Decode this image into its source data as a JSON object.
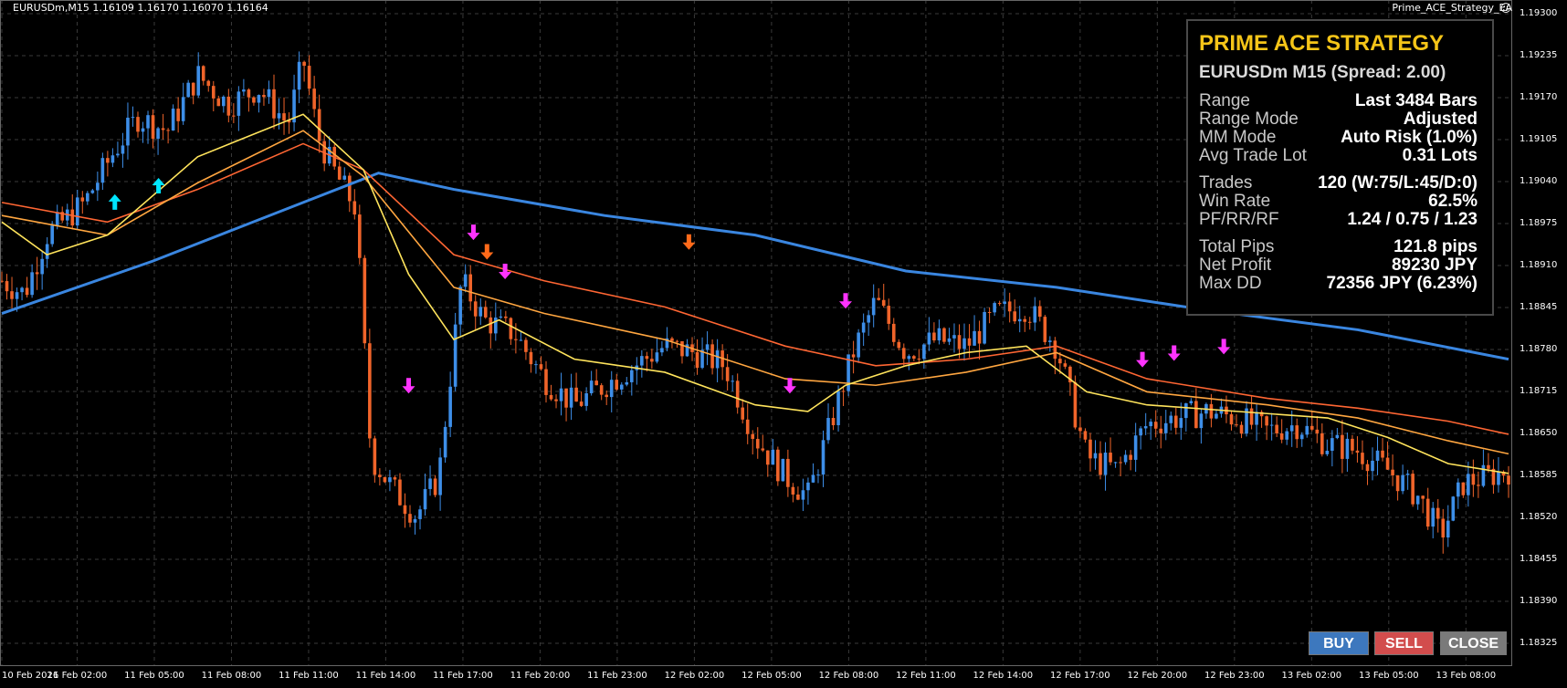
{
  "header": {
    "symbol_info": "EURUSDm,M15  1.16109 1.16170 1.16070 1.16164",
    "ea_name": "Prime_ACE_Strategy_EA",
    "ea_face": "☺"
  },
  "price_axis": {
    "ticks": [
      "1.19300",
      "1.19235",
      "1.19170",
      "1.19105",
      "1.19040",
      "1.18975",
      "1.18910",
      "1.18845",
      "1.18780",
      "1.18715",
      "1.18650",
      "1.18585",
      "1.18520",
      "1.18455",
      "1.18390",
      "1.18325"
    ]
  },
  "time_axis": {
    "ticks": [
      "10 Feb 2026",
      "11 Feb 02:00",
      "11 Feb 05:00",
      "11 Feb 08:00",
      "11 Feb 11:00",
      "11 Feb 14:00",
      "11 Feb 17:00",
      "11 Feb 20:00",
      "11 Feb 23:00",
      "12 Feb 02:00",
      "12 Feb 05:00",
      "12 Feb 08:00",
      "12 Feb 11:00",
      "12 Feb 14:00",
      "12 Feb 17:00",
      "12 Feb 20:00",
      "12 Feb 23:00",
      "13 Feb 02:00",
      "13 Feb 05:00",
      "13 Feb 08:00"
    ]
  },
  "panel": {
    "title": "PRIME ACE STRATEGY",
    "subtitle": "EURUSDm M15 (Spread: 2.00)",
    "group1": [
      {
        "label": "Range",
        "value": "Last 3484 Bars"
      },
      {
        "label": "Range Mode",
        "value": "Adjusted"
      },
      {
        "label": "MM Mode",
        "value": "Auto Risk (1.0%)"
      },
      {
        "label": "Avg Trade Lot",
        "value": "0.31 Lots"
      }
    ],
    "group2": [
      {
        "label": "Trades",
        "value": "120 (W:75/L:45/D:0)"
      },
      {
        "label": "Win Rate",
        "value": "62.5%"
      },
      {
        "label": "PF/RR/RF",
        "value": "1.24 / 0.75 / 1.23"
      }
    ],
    "group3": [
      {
        "label": "Total Pips",
        "value": "121.8 pips"
      },
      {
        "label": "Net Profit",
        "value": "89230 JPY"
      },
      {
        "label": "Max DD",
        "value": "72356 JPY (6.23%)"
      }
    ]
  },
  "buttons": {
    "buy": "BUY",
    "sell": "SELL",
    "close": "CLOSE"
  },
  "colors": {
    "background": "#000000",
    "grid": "#3a3a3a",
    "bull_candle": "#3d8ee8",
    "bear_candle": "#f0642a",
    "ma_slow": "#3a86e0",
    "ma_fast": "#ffe45c",
    "ma_mid": "#ffa640",
    "ma_red": "#ff6633",
    "buy_arrow": "#00e5ff",
    "sell_arrow": "#ff33ff",
    "sell_arrow_orange": "#ff6a1a",
    "panel_title": "#f5c518"
  },
  "chart_data": {
    "type": "candlestick",
    "symbol": "EURUSDm",
    "timeframe": "M15",
    "ylim": [
      1.183,
      1.1932
    ],
    "xrange": [
      "10 Feb 2026",
      "13 Feb 08:00"
    ],
    "close_path": [
      [
        0,
        1.1889
      ],
      [
        0.015,
        1.1887
      ],
      [
        0.03,
        1.1896
      ],
      [
        0.055,
        1.1901
      ],
      [
        0.075,
        1.1909
      ],
      [
        0.09,
        1.1914
      ],
      [
        0.11,
        1.1912
      ],
      [
        0.13,
        1.19205
      ],
      [
        0.15,
        1.1916
      ],
      [
        0.17,
        1.19185
      ],
      [
        0.19,
        1.1913
      ],
      [
        0.2,
        1.1923
      ],
      [
        0.21,
        1.1911
      ],
      [
        0.22,
        1.1906
      ],
      [
        0.235,
        1.19
      ],
      [
        0.245,
        1.1862
      ],
      [
        0.26,
        1.1857
      ],
      [
        0.275,
        1.1853
      ],
      [
        0.29,
        1.1859
      ],
      [
        0.305,
        1.1889
      ],
      [
        0.32,
        1.1883
      ],
      [
        0.34,
        1.1881
      ],
      [
        0.36,
        1.1874
      ],
      [
        0.38,
        1.187
      ],
      [
        0.4,
        1.1873
      ],
      [
        0.42,
        1.1876
      ],
      [
        0.44,
        1.1879
      ],
      [
        0.46,
        1.1878
      ],
      [
        0.48,
        1.1876
      ],
      [
        0.5,
        1.1865
      ],
      [
        0.52,
        1.1859
      ],
      [
        0.535,
        1.1856
      ],
      [
        0.55,
        1.1867
      ],
      [
        0.565,
        1.1878
      ],
      [
        0.58,
        1.1886
      ],
      [
        0.6,
        1.1878
      ],
      [
        0.62,
        1.188
      ],
      [
        0.64,
        1.1879
      ],
      [
        0.66,
        1.1884
      ],
      [
        0.68,
        1.1885
      ],
      [
        0.7,
        1.1879
      ],
      [
        0.72,
        1.1862
      ],
      [
        0.74,
        1.186
      ],
      [
        0.76,
        1.1867
      ],
      [
        0.78,
        1.1868
      ],
      [
        0.8,
        1.1869
      ],
      [
        0.82,
        1.1868
      ],
      [
        0.84,
        1.1866
      ],
      [
        0.86,
        1.1867
      ],
      [
        0.88,
        1.1864
      ],
      [
        0.9,
        1.1863
      ],
      [
        0.92,
        1.186
      ],
      [
        0.94,
        1.1856
      ],
      [
        0.955,
        1.185
      ],
      [
        0.97,
        1.1858
      ],
      [
        1.0,
        1.186
      ]
    ],
    "moving_averages": [
      {
        "key": "ma_slow",
        "path": [
          [
            0,
            1.1884
          ],
          [
            0.1,
            1.1892
          ],
          [
            0.2,
            1.1901
          ],
          [
            0.25,
            1.19055
          ],
          [
            0.3,
            1.1903
          ],
          [
            0.4,
            1.1899
          ],
          [
            0.5,
            1.1896
          ],
          [
            0.6,
            1.18905
          ],
          [
            0.7,
            1.1888
          ],
          [
            0.8,
            1.18845
          ],
          [
            0.9,
            1.18815
          ],
          [
            1.0,
            1.1877
          ]
        ]
      },
      {
        "key": "ma_red",
        "path": [
          [
            0,
            1.1901
          ],
          [
            0.07,
            1.1898
          ],
          [
            0.13,
            1.1903
          ],
          [
            0.2,
            1.191
          ],
          [
            0.24,
            1.1906
          ],
          [
            0.3,
            1.1893
          ],
          [
            0.36,
            1.1889
          ],
          [
            0.44,
            1.1885
          ],
          [
            0.52,
            1.1879
          ],
          [
            0.58,
            1.1876
          ],
          [
            0.64,
            1.1877
          ],
          [
            0.7,
            1.1879
          ],
          [
            0.76,
            1.1874
          ],
          [
            0.84,
            1.1871
          ],
          [
            0.9,
            1.18695
          ],
          [
            0.96,
            1.18675
          ],
          [
            1.0,
            1.18655
          ]
        ]
      },
      {
        "key": "ma_mid",
        "path": [
          [
            0,
            1.1899
          ],
          [
            0.07,
            1.1896
          ],
          [
            0.13,
            1.1904
          ],
          [
            0.2,
            1.1912
          ],
          [
            0.24,
            1.1905
          ],
          [
            0.3,
            1.1888
          ],
          [
            0.36,
            1.1884
          ],
          [
            0.44,
            1.188
          ],
          [
            0.52,
            1.1874
          ],
          [
            0.58,
            1.1873
          ],
          [
            0.64,
            1.1875
          ],
          [
            0.7,
            1.1878
          ],
          [
            0.76,
            1.1872
          ],
          [
            0.84,
            1.187
          ],
          [
            0.9,
            1.1868
          ],
          [
            0.96,
            1.18645
          ],
          [
            1.0,
            1.18625
          ]
        ]
      },
      {
        "key": "ma_fast",
        "path": [
          [
            0,
            1.1898
          ],
          [
            0.03,
            1.1893
          ],
          [
            0.07,
            1.1896
          ],
          [
            0.13,
            1.1908
          ],
          [
            0.2,
            1.19145
          ],
          [
            0.24,
            1.1906
          ],
          [
            0.27,
            1.189
          ],
          [
            0.3,
            1.188
          ],
          [
            0.33,
            1.1883
          ],
          [
            0.38,
            1.1877
          ],
          [
            0.44,
            1.1875
          ],
          [
            0.5,
            1.187
          ],
          [
            0.535,
            1.1869
          ],
          [
            0.56,
            1.1873
          ],
          [
            0.6,
            1.1876
          ],
          [
            0.64,
            1.1878
          ],
          [
            0.68,
            1.1879
          ],
          [
            0.72,
            1.1872
          ],
          [
            0.76,
            1.187
          ],
          [
            0.82,
            1.1869
          ],
          [
            0.88,
            1.1868
          ],
          [
            0.92,
            1.1865
          ],
          [
            0.96,
            1.1861
          ],
          [
            1.0,
            1.18595
          ]
        ]
      }
    ],
    "signals": [
      {
        "dir": "buy",
        "t": 0.075,
        "p": 1.1901
      },
      {
        "dir": "buy",
        "t": 0.104,
        "p": 1.19035
      },
      {
        "dir": "sell",
        "t": 0.27,
        "p": 1.1873
      },
      {
        "dir": "sell",
        "t": 0.313,
        "p": 1.18965
      },
      {
        "dir": "sell_orange",
        "t": 0.322,
        "p": 1.18935
      },
      {
        "dir": "sell",
        "t": 0.334,
        "p": 1.18905
      },
      {
        "dir": "sell_orange",
        "t": 0.456,
        "p": 1.1895
      },
      {
        "dir": "sell",
        "t": 0.523,
        "p": 1.1873
      },
      {
        "dir": "sell",
        "t": 0.56,
        "p": 1.1886
      },
      {
        "dir": "sell",
        "t": 0.757,
        "p": 1.1877
      },
      {
        "dir": "sell",
        "t": 0.778,
        "p": 1.1878
      },
      {
        "dir": "sell",
        "t": 0.811,
        "p": 1.1879
      }
    ]
  }
}
